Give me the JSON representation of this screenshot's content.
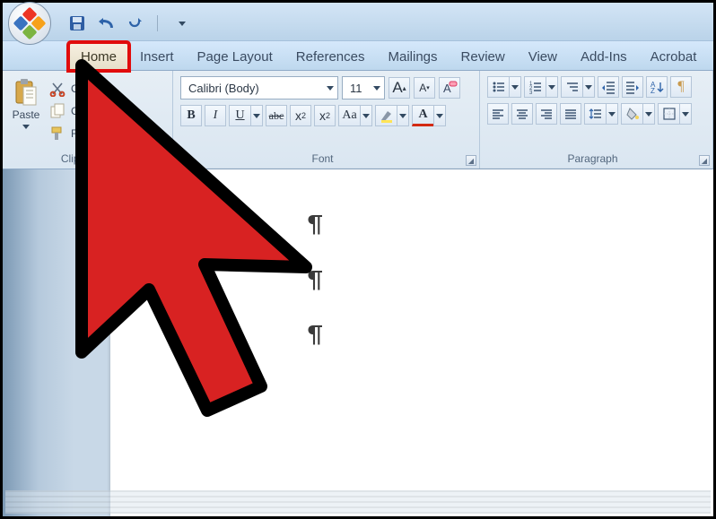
{
  "tabs": {
    "home": "Home",
    "insert": "Insert",
    "page_layout": "Page Layout",
    "references": "References",
    "mailings": "Mailings",
    "review": "Review",
    "view": "View",
    "addins": "Add-Ins",
    "acrobat": "Acrobat"
  },
  "clipboard": {
    "title": "Clipboard",
    "paste": "Paste",
    "cut": "Cut",
    "copy": "Copy",
    "format_painter": "Format Painter"
  },
  "font": {
    "title": "Font",
    "name": "Calibri (Body)",
    "size": "11",
    "bold": "B",
    "italic": "I",
    "underline": "U",
    "strike": "abc",
    "sub": "x",
    "sup": "x",
    "case": "Aa",
    "grow": "A",
    "shrink": "A",
    "clear": "A",
    "font_color": "A"
  },
  "paragraph": {
    "title": "Paragraph",
    "pilcrow": "¶"
  },
  "document": {
    "p1": "¶",
    "p2": "¶",
    "p3": "¶"
  }
}
